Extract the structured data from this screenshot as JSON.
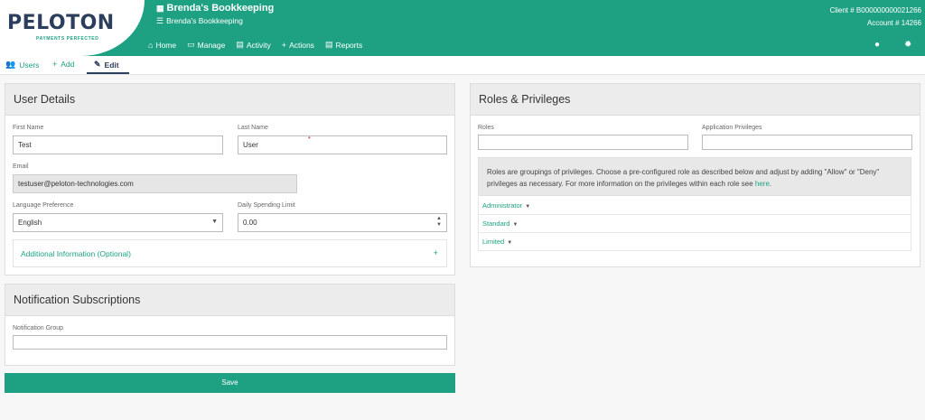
{
  "brand": {
    "name": "PELOTON",
    "tagline": "PAYMENTS PERFECTED"
  },
  "header": {
    "title": "Brenda's Bookkeeping",
    "subtitle": "Brenda's Bookkeeping",
    "client_label": "Client # B000000000021266",
    "account_label": "Account # 14266"
  },
  "nav": [
    {
      "label": "Home",
      "icon": "home-icon"
    },
    {
      "label": "Manage",
      "icon": "monitor-icon"
    },
    {
      "label": "Activity",
      "icon": "document-icon"
    },
    {
      "label": "Actions",
      "icon": "plus-icon"
    },
    {
      "label": "Reports",
      "icon": "report-icon"
    }
  ],
  "tabs": [
    {
      "label": "Users",
      "icon": "users-icon"
    },
    {
      "label": "Add",
      "icon": "plus-icon"
    },
    {
      "label": "Edit",
      "icon": "edit-icon"
    }
  ],
  "user_details": {
    "title": "User Details",
    "first_name_label": "First Name",
    "first_name_value": "Test",
    "last_name_label": "Last Name",
    "last_name_value": "User",
    "email_label": "Email",
    "email_value": "testuser@peloton-technologies.com",
    "language_label": "Language Preference",
    "language_value": "English",
    "spending_label": "Daily Spending Limit",
    "spending_value": "0.00",
    "additional_label": "Additional Information (Optional)"
  },
  "notifications": {
    "title": "Notification Subscriptions",
    "group_label": "Notification Group",
    "group_value": ""
  },
  "save_label": "Save",
  "roles": {
    "title": "Roles & Privileges",
    "roles_label": "Roles",
    "app_priv_label": "Application Privileges",
    "info_text": "Roles are groupings of privileges. Choose a pre-configured role as described below and adjust by adding \"Allow\" or \"Deny\" privileges as necessary. For more information on the privileges within each role see",
    "info_link": "here",
    "role_list": [
      "Administrator",
      "Standard",
      "Limited"
    ]
  },
  "colors": {
    "brand_green": "#1ea183",
    "brand_navy": "#2b3e5c"
  }
}
